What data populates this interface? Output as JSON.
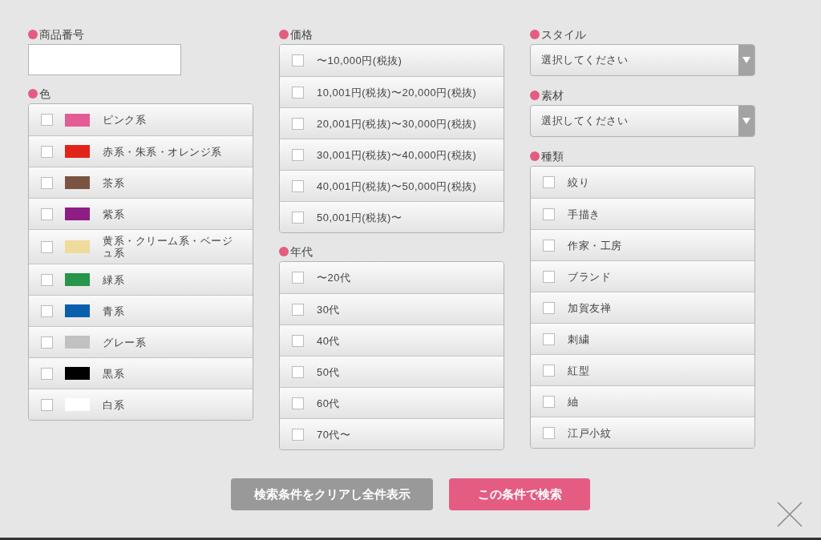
{
  "product_number": {
    "label": "商品番号"
  },
  "colors": {
    "label": "色",
    "items": [
      {
        "label": "ピンク系",
        "color": "#e45c95",
        "checked": false
      },
      {
        "label": "赤系・朱系・オレンジ系",
        "color": "#e2231a",
        "checked": false
      },
      {
        "label": "茶系",
        "color": "#7a5443",
        "checked": false
      },
      {
        "label": "紫系",
        "color": "#8e1d84",
        "checked": false
      },
      {
        "label": "黄系・クリーム系・ベージュ系",
        "color": "#efdb9b",
        "checked": false
      },
      {
        "label": "緑系",
        "color": "#27954a",
        "checked": false
      },
      {
        "label": "青系",
        "color": "#0a5fad",
        "checked": false
      },
      {
        "label": "グレー系",
        "color": "#c1c1c1",
        "checked": false
      },
      {
        "label": "黒系",
        "color": "#000000",
        "checked": false
      },
      {
        "label": "白系",
        "color": "#ffffff",
        "checked": false
      }
    ]
  },
  "price": {
    "label": "価格",
    "items": [
      {
        "label": "〜10,000円(税抜)",
        "checked": false
      },
      {
        "label": "10,001円(税抜)〜20,000円(税抜)",
        "checked": false
      },
      {
        "label": "20,001円(税抜)〜30,000円(税抜)",
        "checked": false
      },
      {
        "label": "30,001円(税抜)〜40,000円(税抜)",
        "checked": false
      },
      {
        "label": "40,001円(税抜)〜50,000円(税抜)",
        "checked": false
      },
      {
        "label": "50,001円(税抜)〜",
        "checked": false
      }
    ]
  },
  "age": {
    "label": "年代",
    "items": [
      {
        "label": "〜20代",
        "checked": false
      },
      {
        "label": "30代",
        "checked": false
      },
      {
        "label": "40代",
        "checked": false
      },
      {
        "label": "50代",
        "checked": false
      },
      {
        "label": "60代",
        "checked": false
      },
      {
        "label": "70代〜",
        "checked": false
      }
    ]
  },
  "style": {
    "label": "スタイル",
    "value": "選択してください"
  },
  "material": {
    "label": "素材",
    "value": "選択してください"
  },
  "type": {
    "label": "種類",
    "items": [
      {
        "label": "絞り",
        "checked": false
      },
      {
        "label": "手描き",
        "checked": false
      },
      {
        "label": "作家・工房",
        "checked": false
      },
      {
        "label": "ブランド",
        "checked": false
      },
      {
        "label": "加賀友禅",
        "checked": false
      },
      {
        "label": "刺繍",
        "checked": false
      },
      {
        "label": "紅型",
        "checked": false
      },
      {
        "label": "紬",
        "checked": false
      },
      {
        "label": "江戸小紋",
        "checked": false
      }
    ]
  },
  "buttons": {
    "clear": "検索条件をクリアし全件表示",
    "search": "この条件で検索"
  }
}
